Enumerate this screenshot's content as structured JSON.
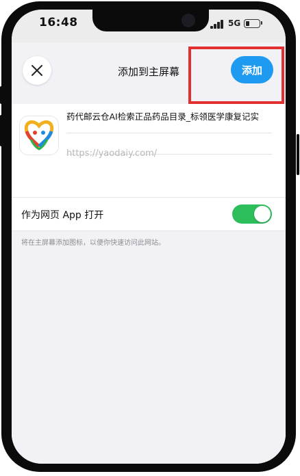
{
  "status_bar": {
    "time": "16:48",
    "network": "5G"
  },
  "sheet": {
    "title": "添加到主屏幕",
    "add_label": "添加",
    "close_icon": "close-icon",
    "highlight_color": "#e03030",
    "accent_color": "#1e9bf0"
  },
  "app": {
    "name": "药代邮云仓AI检索正品药品目录_标领医学康复记实",
    "url_placeholder": "https://yaodaiy.com/"
  },
  "web_app": {
    "label": "作为网页 App 打开",
    "toggle_on": true,
    "toggle_color": "#2dbd5b",
    "note": "将在主屏幕添加图标，以便你快速访问此网站。"
  }
}
